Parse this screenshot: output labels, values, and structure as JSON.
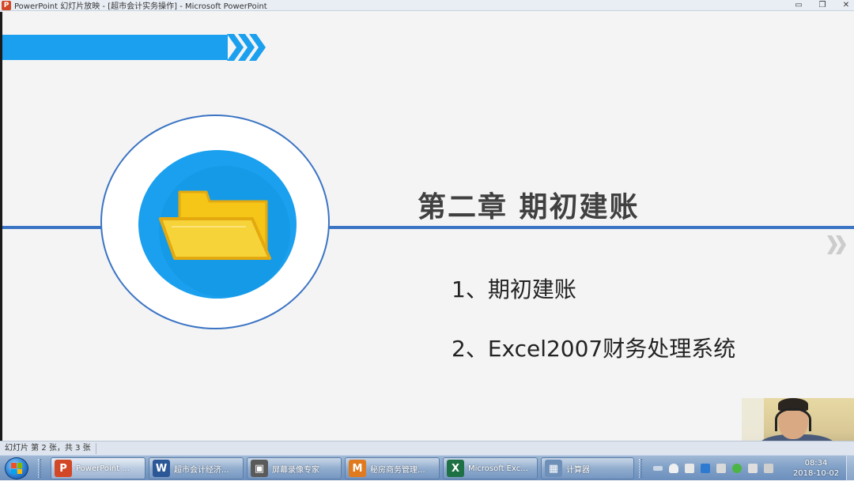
{
  "window": {
    "app_icon_letter": "P",
    "title": "PowerPoint 幻灯片放映 - [超市会计实务操作] - Microsoft PowerPoint",
    "controls": {
      "minimize": "▭",
      "restore": "❐",
      "close": "✕"
    }
  },
  "slide": {
    "chapter_title": "第二章  期初建账",
    "items": [
      "1、期初建账",
      "2、Excel2007财务处理系统"
    ],
    "colors": {
      "accent_blue": "#1aa0ee",
      "line_blue": "#3b74c4",
      "folder_yellow": "#f5c518"
    },
    "icons": {
      "folder": "folder-icon",
      "chevrons": "double-chevron-right-icon"
    }
  },
  "statusbar": {
    "slide_info": "幻灯片 第 2 张，共 3 张"
  },
  "taskbar": {
    "buttons": [
      {
        "label": "PowerPoint ...",
        "icon_text": "P",
        "color": "#d24726"
      },
      {
        "label": "超市会计经济...",
        "icon_text": "W",
        "color": "#2b5797"
      },
      {
        "label": "屏幕录像专家",
        "icon_text": "▣",
        "color": "#5a5a5a"
      },
      {
        "label": "秘房商务管理...",
        "icon_text": "M",
        "color": "#e07a1f"
      },
      {
        "label": "Microsoft Exc...",
        "icon_text": "X",
        "color": "#1e7145"
      },
      {
        "label": "计算器",
        "icon_text": "▦",
        "color": "#6d8fb8"
      }
    ],
    "clock": {
      "time": "08:34",
      "date": "2018-10-02"
    }
  }
}
